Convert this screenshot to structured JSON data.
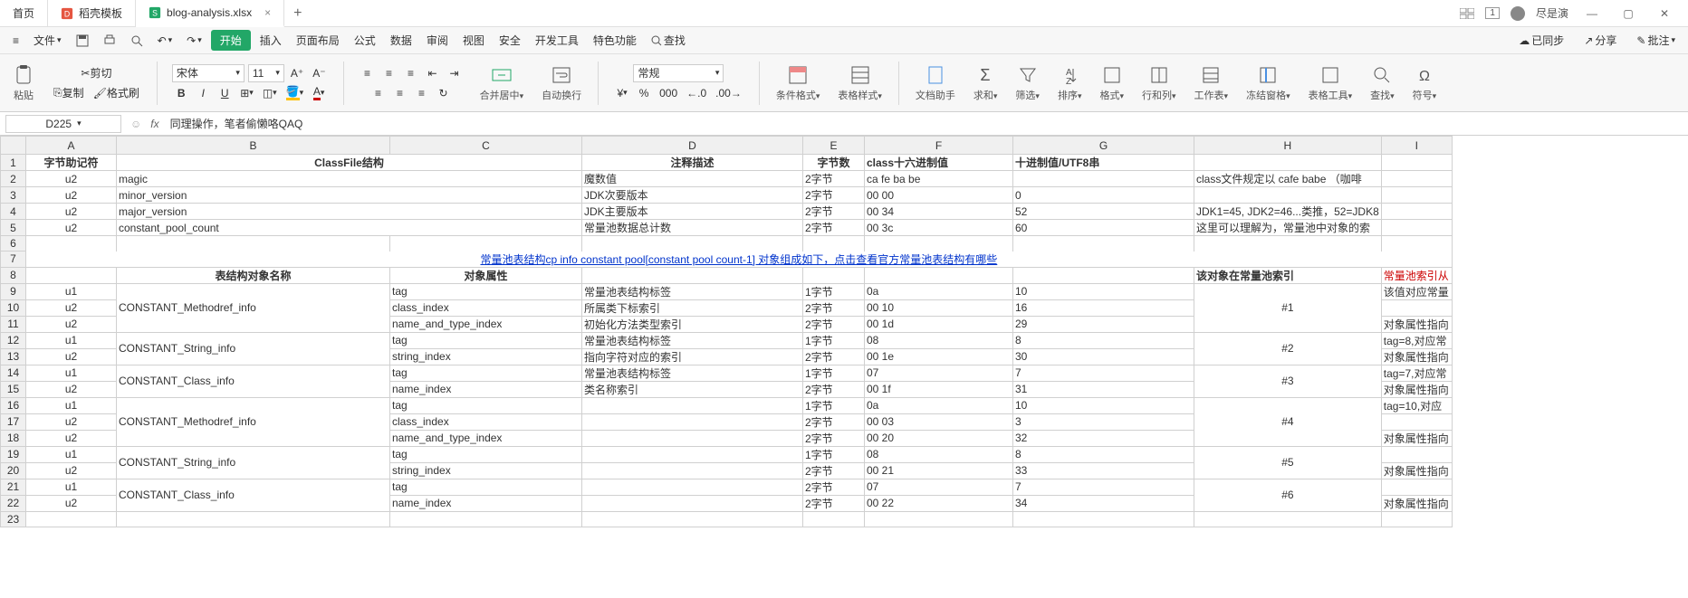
{
  "tabs": [
    {
      "label": "首页",
      "icon_color": "#3a6ea5"
    },
    {
      "label": "稻壳模板",
      "icon_color": "#e55641"
    },
    {
      "label": "blog-analysis.xlsx",
      "icon_color": "#22a767",
      "active": true
    }
  ],
  "user": {
    "name": "尽是演",
    "badge": "1"
  },
  "menubar": {
    "hamburger": "≡",
    "file": "文件",
    "items": [
      "开始",
      "插入",
      "页面布局",
      "公式",
      "数据",
      "审阅",
      "视图",
      "安全",
      "开发工具",
      "特色功能"
    ],
    "search": "查找",
    "right": [
      "已同步",
      "分享",
      "批注"
    ]
  },
  "toolbar": {
    "paste": "粘贴",
    "cut": "剪切",
    "copy": "复制",
    "fmtpaint": "格式刷",
    "font_name": "宋体",
    "font_size": "11",
    "bold": "B",
    "italic": "I",
    "underline": "U",
    "merge": "合并居中",
    "wrap": "自动换行",
    "numfmt": "常规",
    "condfmt": "条件格式",
    "tblfmt": "表格样式",
    "dochelper": "文档助手",
    "sum": "求和",
    "filter": "筛选",
    "sort": "排序",
    "format": "格式",
    "rowcol": "行和列",
    "sheet": "工作表",
    "freeze": "冻结窗格",
    "tbltools": "表格工具",
    "find": "查找",
    "symbol": "符号"
  },
  "namebox": {
    "cell": "D225",
    "formula": "同理操作，笔者偷懒咯QAQ"
  },
  "columns": [
    "A",
    "B",
    "C",
    "D",
    "E",
    "F",
    "G",
    "H",
    "I"
  ],
  "header_row": {
    "A": "字节助记符",
    "B": "ClassFile结构",
    "C": "",
    "D": "注释描述",
    "E": "字节数",
    "F": "class十六进制值",
    "G": "十进制值/UTF8串",
    "H": "",
    "I": ""
  },
  "rows_top": [
    {
      "r": 2,
      "A": "u2",
      "B": "magic",
      "D": "魔数值",
      "E": "2字节",
      "F": "ca fe ba be",
      "G": "",
      "H": "class文件规定以 cafe babe （咖啡"
    },
    {
      "r": 3,
      "A": "u2",
      "B": "minor_version",
      "D": "JDK次要版本",
      "E": "2字节",
      "F": "00 00",
      "G": "0",
      "H": ""
    },
    {
      "r": 4,
      "A": "u2",
      "B": "major_version",
      "D": "JDK主要版本",
      "E": "2字节",
      "F": "00 34",
      "G": "52",
      "H": "JDK1=45, JDK2=46...类推，52=JDK8"
    },
    {
      "r": 5,
      "A": "u2",
      "B": "constant_pool_count",
      "D": "常量池数据总计数",
      "E": "2字节",
      "F": "00 3c",
      "G": "60",
      "H": "这里可以理解为，常量池中对象的索"
    }
  ],
  "link_row": {
    "r": 7,
    "text": "常量池表结构cp info constant pool[constant pool count-1] 对象组成如下，点击查看官方常量池表结构有哪些"
  },
  "header_row2": {
    "r": 8,
    "B": "表结构对象名称",
    "C": "对象属性",
    "H": "该对象在常量池索引",
    "I": "常量池索引从"
  },
  "rows_bottom": [
    {
      "r": 9,
      "A": "u1",
      "B": "",
      "C": "tag",
      "D": "常量池表结构标签",
      "E": "1字节",
      "F": "0a",
      "G": "10",
      "H": "",
      "I": "该值对应常量"
    },
    {
      "r": 10,
      "A": "u2",
      "B": "CONSTANT_Methodref_info",
      "C": "class_index",
      "D": "所属类下标索引",
      "E": "2字节",
      "F": "00 10",
      "G": "16",
      "H": "#1",
      "I": ""
    },
    {
      "r": 11,
      "A": "u2",
      "B": "",
      "C": "name_and_type_index",
      "D": "初始化方法类型索引",
      "E": "2字节",
      "F": "00 1d",
      "G": "29",
      "H": "",
      "I": "对象属性指向"
    },
    {
      "r": 12,
      "A": "u1",
      "B": "",
      "C": "tag",
      "D": "常量池表结构标签",
      "E": "1字节",
      "F": "08",
      "G": "8",
      "H": "",
      "I": "tag=8,对应常"
    },
    {
      "r": 13,
      "A": "u2",
      "B": "CONSTANT_String_info",
      "C": "string_index",
      "D": "指向字符对应的索引",
      "E": "2字节",
      "F": "00 1e",
      "G": "30",
      "H": "#2",
      "I": "对象属性指向"
    },
    {
      "r": 14,
      "A": "u1",
      "B": "",
      "C": "tag",
      "D": "常量池表结构标签",
      "E": "1字节",
      "F": "07",
      "G": "7",
      "H": "",
      "I": "tag=7,对应常"
    },
    {
      "r": 15,
      "A": "u2",
      "B": "CONSTANT_Class_info",
      "C": "name_index",
      "D": "类名称索引",
      "E": "2字节",
      "F": "00 1f",
      "G": "31",
      "H": "#3",
      "I": "对象属性指向"
    },
    {
      "r": 16,
      "A": "u1",
      "B": "",
      "C": "tag",
      "D": "",
      "E": "1字节",
      "F": "0a",
      "G": "10",
      "H": "",
      "I": "tag=10,对应"
    },
    {
      "r": 17,
      "A": "u2",
      "B": "CONSTANT_Methodref_info",
      "C": "class_index",
      "D": "",
      "E": "2字节",
      "F": "00 03",
      "G": "3",
      "H": "#4",
      "I": ""
    },
    {
      "r": 18,
      "A": "u2",
      "B": "",
      "C": "name_and_type_index",
      "D": "",
      "E": "2字节",
      "F": "00 20",
      "G": "32",
      "H": "",
      "I": "对象属性指向"
    },
    {
      "r": 19,
      "A": "u1",
      "B": "",
      "C": "tag",
      "D": "",
      "E": "1字节",
      "F": "08",
      "G": "8",
      "H": "",
      "I": ""
    },
    {
      "r": 20,
      "A": "u2",
      "B": "CONSTANT_String_info",
      "C": "string_index",
      "D": "",
      "E": "2字节",
      "F": "00 21",
      "G": "33",
      "H": "#5",
      "I": "对象属性指向"
    },
    {
      "r": 21,
      "A": "u1",
      "B": "",
      "C": "tag",
      "D": "",
      "E": "2字节",
      "F": "07",
      "G": "7",
      "H": "",
      "I": ""
    },
    {
      "r": 22,
      "A": "u2",
      "B": "CONSTANT_Class_info",
      "C": "name_index",
      "D": "",
      "E": "2字节",
      "F": "00 22",
      "G": "34",
      "H": "#6",
      "I": "对象属性指向"
    }
  ],
  "merge_groups": [
    {
      "start": 9,
      "end": 11,
      "B": "CONSTANT_Methodref_info",
      "H": "#1"
    },
    {
      "start": 12,
      "end": 13,
      "B": "CONSTANT_String_info",
      "H": "#2"
    },
    {
      "start": 14,
      "end": 15,
      "B": "CONSTANT_Class_info",
      "H": "#3"
    },
    {
      "start": 16,
      "end": 18,
      "B": "CONSTANT_Methodref_info",
      "H": "#4"
    },
    {
      "start": 19,
      "end": 20,
      "B": "CONSTANT_String_info",
      "H": "#5"
    },
    {
      "start": 21,
      "end": 22,
      "B": "CONSTANT_Class_info",
      "H": "#6"
    }
  ]
}
